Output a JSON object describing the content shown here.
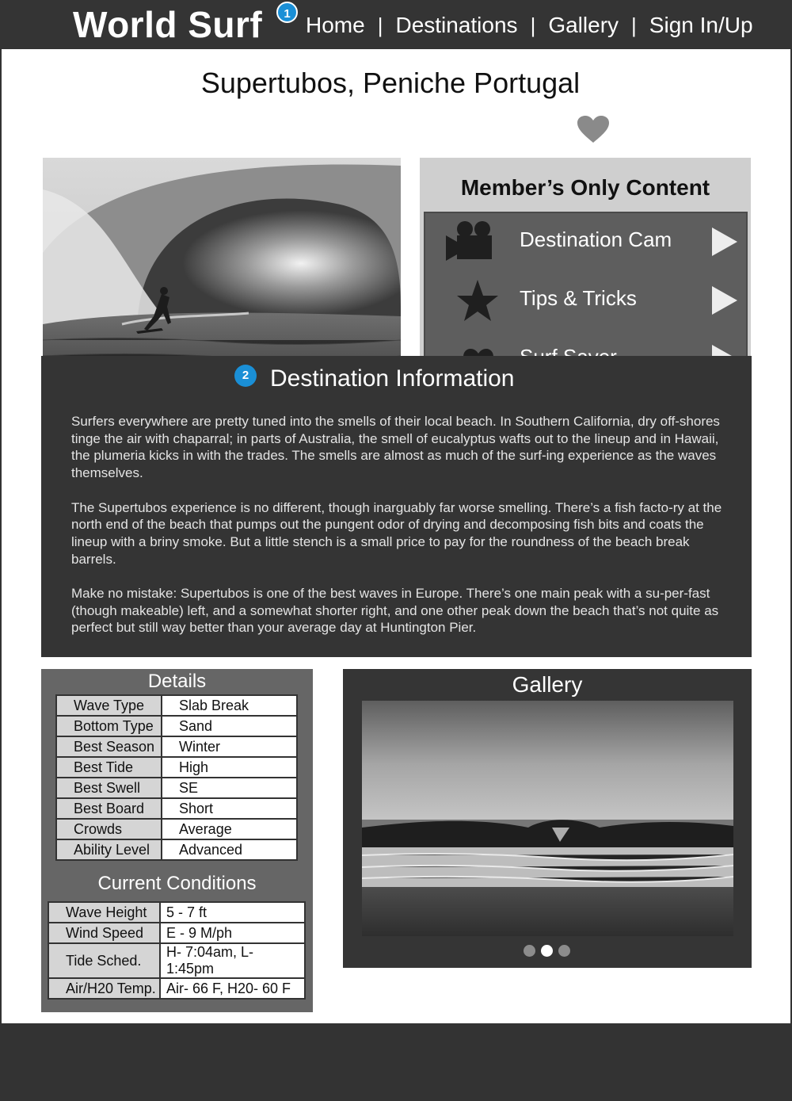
{
  "header": {
    "logo": "World Surf",
    "badge": "1",
    "nav": [
      {
        "label": "Home"
      },
      {
        "label": "Destinations"
      },
      {
        "label": "Gallery"
      },
      {
        "label": "Sign In/Up"
      }
    ],
    "separator": "|"
  },
  "page": {
    "title": "Supertubos, Peniche Portugal",
    "favorite_icon": "heart-icon"
  },
  "members": {
    "heading": "Member’s Only Content",
    "items": [
      {
        "label": "Destination Cam",
        "icon": "video-camera-icon"
      },
      {
        "label": "Tips & Tricks",
        "icon": "star-icon"
      },
      {
        "label": "Surf Saver",
        "icon": "heart-icon"
      }
    ]
  },
  "info": {
    "badge": "2",
    "heading": "Destination Information",
    "paragraphs": [
      "Surfers everywhere are pretty tuned into the smells of their local beach. In Southern California, dry off-shores tinge the air with chaparral; in parts of Australia, the smell of eucalyptus wafts out to the lineup and in Hawaii, the plumeria kicks in with the trades. The smells are almost as much of the surf-ing experience as the waves themselves.",
      "The Supertubos experience is no different, though inarguably far worse smelling. There’s a fish facto-ry at the north end of the beach that pumps out the pungent odor of drying and decomposing fish bits and coats the lineup with a briny smoke. But a little stench is a small price to pay for the roundness of the beach break barrels.",
      "Make no mistake: Supertubos is one of the best waves in Europe. There’s one main peak with a su-per-fast (though makeable) left, and a somewhat shorter right, and one other peak down the beach that’s not quite as perfect but still way better than your average day at Huntington Pier."
    ]
  },
  "details": {
    "heading": "Details",
    "rows": [
      {
        "key": "Wave Type",
        "value": "Slab Break"
      },
      {
        "key": "Bottom Type",
        "value": "Sand"
      },
      {
        "key": "Best Season",
        "value": "Winter"
      },
      {
        "key": "Best Tide",
        "value": "High"
      },
      {
        "key": "Best Swell",
        "value": "SE"
      },
      {
        "key": "Best Board",
        "value": "Short"
      },
      {
        "key": "Crowds",
        "value": "Average"
      },
      {
        "key": "Ability Level",
        "value": "Advanced"
      }
    ]
  },
  "conditions": {
    "heading": "Current Conditions",
    "rows": [
      {
        "key": "Wave Height",
        "value": "5 - 7 ft"
      },
      {
        "key": "Wind Speed",
        "value": "E - 9 M/ph"
      },
      {
        "key": "Tide Sched.",
        "value": "H- 7:04am, L- 1:45pm"
      },
      {
        "key": "Air/H20 Temp.",
        "value": "Air- 66 F,  H20- 60 F"
      }
    ]
  },
  "gallery": {
    "heading": "Gallery",
    "slides": 3,
    "active_slide": 2
  },
  "colors": {
    "dark": "#343434",
    "badge": "#1a8fd6",
    "panel_gray": "#5e5e5e"
  }
}
